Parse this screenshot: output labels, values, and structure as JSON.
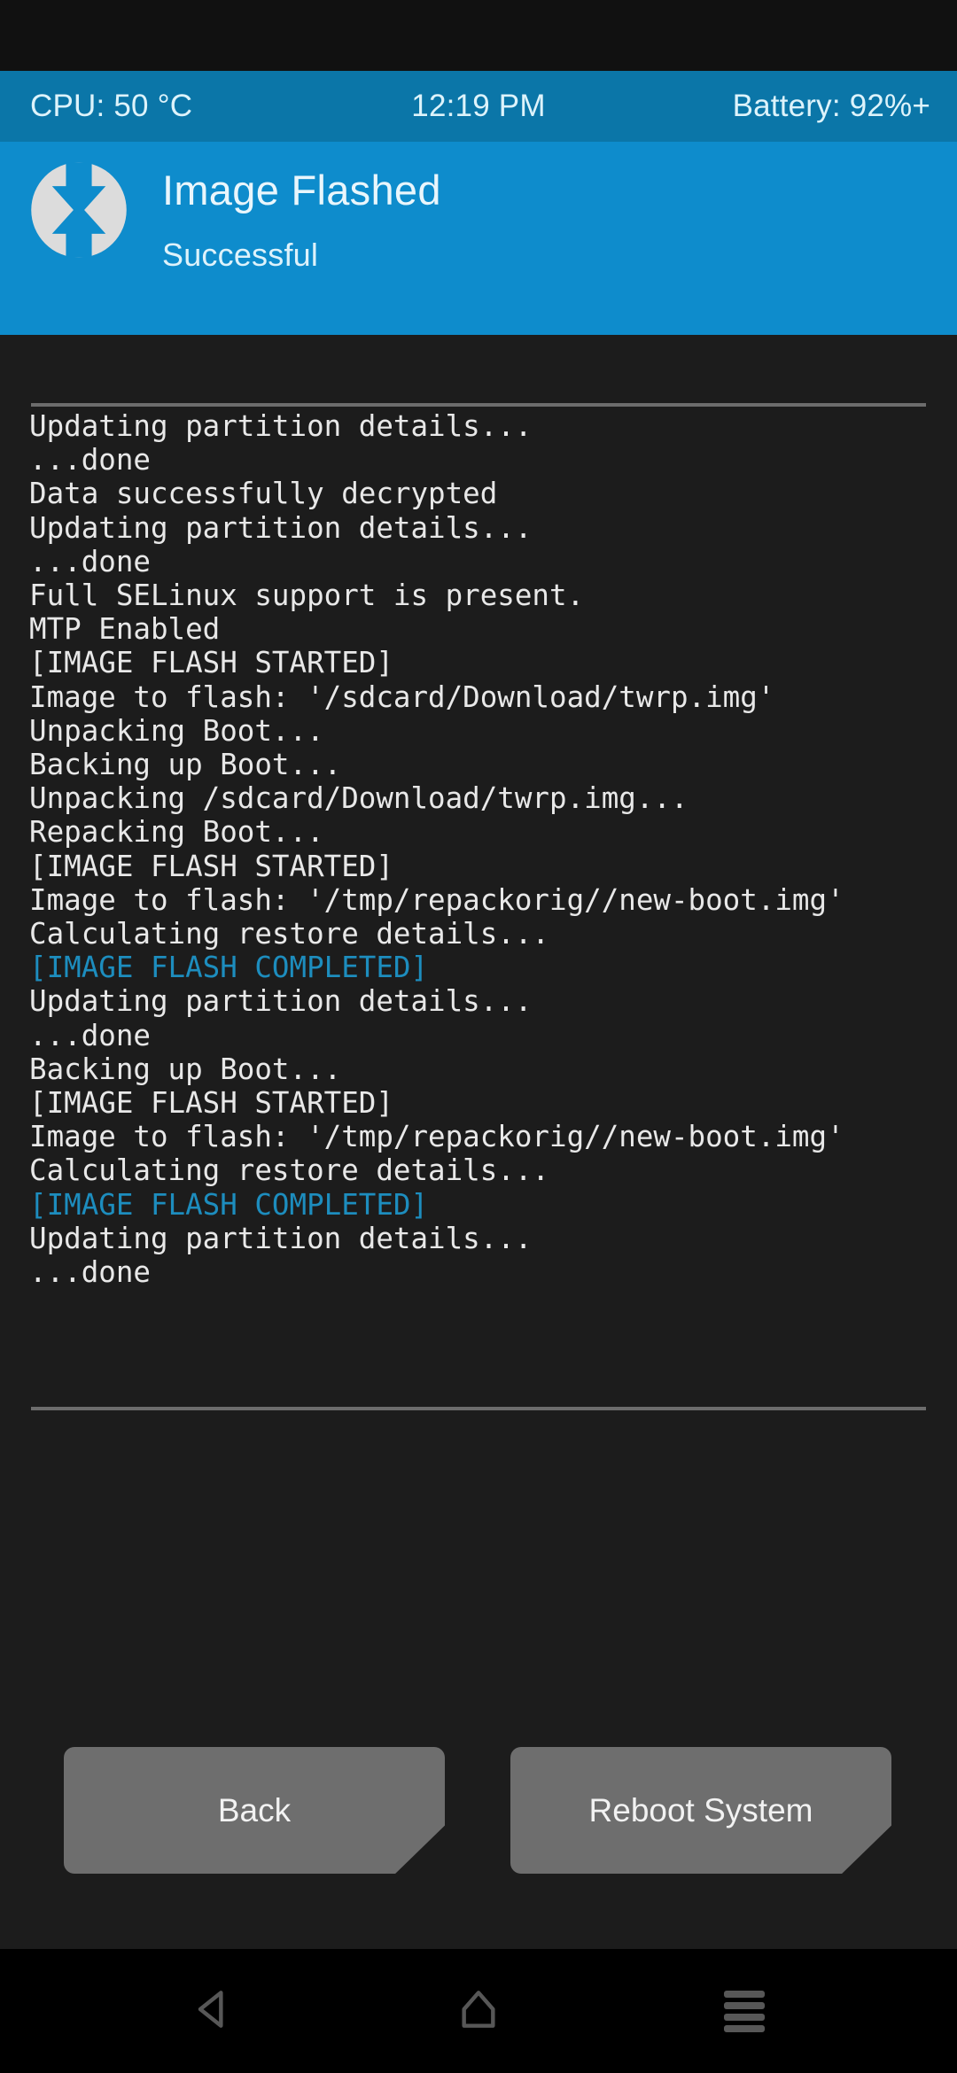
{
  "status_bar": {
    "cpu": "CPU: 50 °C",
    "time": "12:19 PM",
    "battery": "Battery: 92%+",
    "background_color": "#0b76a8",
    "text_color": "#ddf3fb"
  },
  "header": {
    "title": "Image Flashed",
    "subtitle": "Successful",
    "logo_name": "twrp-logo-icon",
    "background_color": "#0e8ccc",
    "text_color": "#e9f6fc"
  },
  "console": {
    "background_color": "#1c1c1c",
    "text_color": "#e8e8e8",
    "highlight_color": "#1d8dbe",
    "lines": [
      {
        "text": "Updating partition details...",
        "style": "normal"
      },
      {
        "text": "...done",
        "style": "normal"
      },
      {
        "text": "Data successfully decrypted",
        "style": "normal"
      },
      {
        "text": "Updating partition details...",
        "style": "normal"
      },
      {
        "text": "...done",
        "style": "normal"
      },
      {
        "text": "Full SELinux support is present.",
        "style": "normal"
      },
      {
        "text": "MTP Enabled",
        "style": "normal"
      },
      {
        "text": "[IMAGE FLASH STARTED]",
        "style": "normal"
      },
      {
        "text": "Image to flash: '/sdcard/Download/twrp.img'",
        "style": "normal"
      },
      {
        "text": "Unpacking Boot...",
        "style": "normal"
      },
      {
        "text": "Backing up Boot...",
        "style": "normal"
      },
      {
        "text": "Unpacking /sdcard/Download/twrp.img...",
        "style": "normal"
      },
      {
        "text": "Repacking Boot...",
        "style": "normal"
      },
      {
        "text": "[IMAGE FLASH STARTED]",
        "style": "normal"
      },
      {
        "text": "Image to flash: '/tmp/repackorig//new-boot.img'",
        "style": "normal"
      },
      {
        "text": "Calculating restore details...",
        "style": "normal"
      },
      {
        "text": "[IMAGE FLASH COMPLETED]",
        "style": "completed"
      },
      {
        "text": "Updating partition details...",
        "style": "normal"
      },
      {
        "text": "...done",
        "style": "normal"
      },
      {
        "text": "Backing up Boot...",
        "style": "normal"
      },
      {
        "text": "[IMAGE FLASH STARTED]",
        "style": "normal"
      },
      {
        "text": "Image to flash: '/tmp/repackorig//new-boot.img'",
        "style": "normal"
      },
      {
        "text": "Calculating restore details...",
        "style": "normal"
      },
      {
        "text": "[IMAGE FLASH COMPLETED]",
        "style": "completed"
      },
      {
        "text": "Updating partition details...",
        "style": "normal"
      },
      {
        "text": "...done",
        "style": "normal"
      }
    ]
  },
  "actions": {
    "back_label": "Back",
    "reboot_label": "Reboot System",
    "button_color": "#6e6e6e"
  },
  "navigation_bar": {
    "back_icon": "back-triangle-icon",
    "home_icon": "home-icon",
    "menu_icon": "menu-hamburger-icon",
    "icon_color": "#575757",
    "background_color": "#000000"
  }
}
